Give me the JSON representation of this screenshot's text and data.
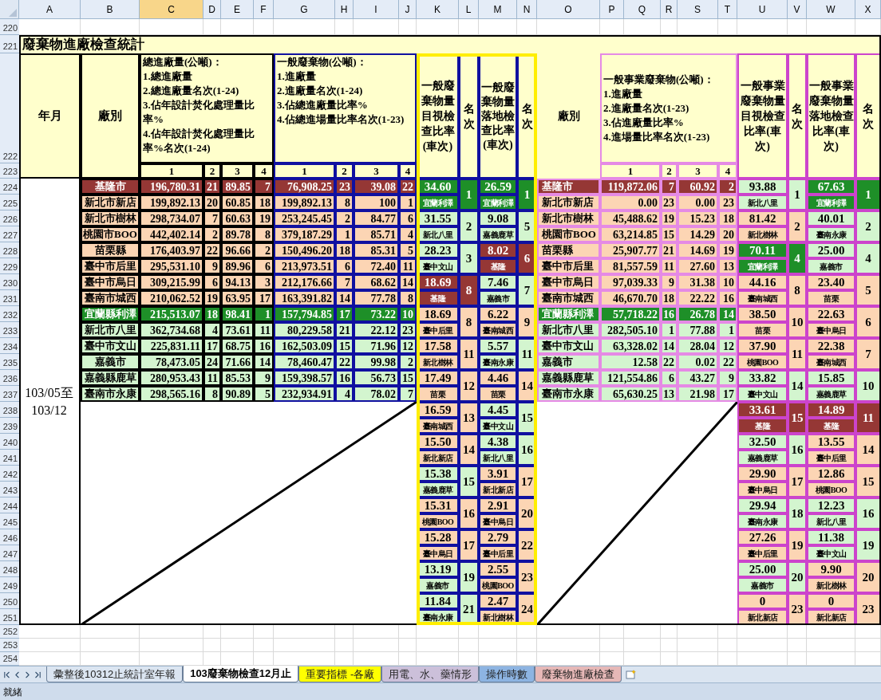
{
  "columns": [
    {
      "label": "A",
      "selected": false
    },
    {
      "label": "B",
      "selected": false
    },
    {
      "label": "C",
      "selected": true
    },
    {
      "label": "D",
      "selected": false
    },
    {
      "label": "E",
      "selected": false
    },
    {
      "label": "F",
      "selected": false
    },
    {
      "label": "G",
      "selected": false
    },
    {
      "label": "H",
      "selected": false
    },
    {
      "label": "I",
      "selected": false
    },
    {
      "label": "J",
      "selected": false
    },
    {
      "label": "K",
      "selected": false
    },
    {
      "label": "L",
      "selected": false
    },
    {
      "label": "M",
      "selected": false
    },
    {
      "label": "N",
      "selected": false
    },
    {
      "label": "O",
      "selected": false
    },
    {
      "label": "P",
      "selected": false
    },
    {
      "label": "Q",
      "selected": false
    },
    {
      "label": "R",
      "selected": false
    },
    {
      "label": "S",
      "selected": false
    },
    {
      "label": "T",
      "selected": false
    },
    {
      "label": "U",
      "selected": false
    },
    {
      "label": "V",
      "selected": false
    },
    {
      "label": "W",
      "selected": false
    },
    {
      "label": "X",
      "selected": false
    }
  ],
  "row_numbers": [
    "220",
    "221",
    "222",
    "223",
    "224",
    "225",
    "226",
    "227",
    "228",
    "229",
    "230",
    "231",
    "232",
    "233",
    "234",
    "235",
    "236",
    "237",
    "238",
    "239",
    "240",
    "241",
    "242",
    "243",
    "244",
    "245",
    "246",
    "247",
    "248",
    "249",
    "250",
    "251",
    "252",
    "253",
    "254"
  ],
  "title": "廢棄物進廠檢查統計",
  "left_table": {
    "period_header": "年月",
    "plant_header": "廠別",
    "total_header": "總進廠量(公噸)：\n1.總進廠量\n2.總進廠量名次(1-24)\n3.佔年設計焚化處理量比率%\n4.佔年設計焚化處理量比率%名次(1-24)",
    "total_subcolumns": [
      "1",
      "2",
      "3",
      "4"
    ],
    "general_header": "一般廢棄物(公噸)：\n1.進廠量\n2.進廠量名次(1-24)\n3.佔總進廠量比率%\n4.佔總進場量比率名次(1-23)",
    "general_subcolumns": [
      "1",
      "2",
      "3",
      "4"
    ],
    "period": "103/05至\n103/12",
    "rows": [
      {
        "plant": "基隆市",
        "color": "#953735",
        "values": [
          "196,780.31",
          "21",
          "89.85",
          "7",
          "76,908.25",
          "23",
          "39.08",
          "22"
        ]
      },
      {
        "plant": "新北市新店",
        "color": "#fcd5b4",
        "values": [
          "199,892.13",
          "20",
          "60.85",
          "18",
          "199,892.13",
          "8",
          "100",
          "1"
        ]
      },
      {
        "plant": "新北市樹林",
        "color": "#fcd5b4",
        "values": [
          "298,734.07",
          "7",
          "60.63",
          "19",
          "253,245.45",
          "2",
          "84.77",
          "6"
        ]
      },
      {
        "plant": "桃園市BOO",
        "color": "#fcd5b4",
        "values": [
          "442,402.14",
          "2",
          "89.78",
          "8",
          "379,187.29",
          "1",
          "85.71",
          "4"
        ]
      },
      {
        "plant": "苗栗縣",
        "color": "#fcd5b4",
        "values": [
          "176,403.97",
          "22",
          "96.66",
          "2",
          "150,496.20",
          "18",
          "85.31",
          "5"
        ]
      },
      {
        "plant": "臺中市后里",
        "color": "#fcd5b4",
        "values": [
          "295,531.10",
          "9",
          "89.96",
          "6",
          "213,973.51",
          "6",
          "72.40",
          "11"
        ]
      },
      {
        "plant": "臺中市烏日",
        "color": "#fcd5b4",
        "values": [
          "309,215.99",
          "6",
          "94.13",
          "3",
          "212,176.66",
          "7",
          "68.62",
          "14"
        ]
      },
      {
        "plant": "臺南市城西",
        "color": "#fcd5b4",
        "values": [
          "210,062.52",
          "19",
          "63.95",
          "17",
          "163,391.82",
          "14",
          "77.78",
          "8"
        ]
      },
      {
        "plant": "宜蘭縣利澤",
        "color": "#1e8f28",
        "values": [
          "215,513.07",
          "18",
          "98.41",
          "1",
          "157,794.85",
          "17",
          "73.22",
          "10"
        ]
      },
      {
        "plant": "新北市八里",
        "color": "#d3f5cf",
        "values": [
          "362,734.68",
          "4",
          "73.61",
          "11",
          "80,229.58",
          "21",
          "22.12",
          "23"
        ]
      },
      {
        "plant": "臺中市文山",
        "color": "#d3f5cf",
        "values": [
          "225,831.11",
          "17",
          "68.75",
          "16",
          "162,503.09",
          "15",
          "71.96",
          "12"
        ]
      },
      {
        "plant": "嘉義市",
        "color": "#d3f5cf",
        "values": [
          "78,473.05",
          "24",
          "71.66",
          "14",
          "78,460.47",
          "22",
          "99.98",
          "2"
        ]
      },
      {
        "plant": "嘉義縣鹿草",
        "color": "#d3f5cf",
        "values": [
          "280,953.43",
          "11",
          "85.53",
          "9",
          "159,398.57",
          "16",
          "56.73",
          "15"
        ]
      },
      {
        "plant": "臺南市永康",
        "color": "#d3f5cf",
        "values": [
          "298,565.16",
          "8",
          "90.89",
          "5",
          "232,934.91",
          "4",
          "78.02",
          "7"
        ]
      }
    ]
  },
  "general_inspection": {
    "visual_header": "一般廢棄物量目視檢查比率(車次)",
    "visual_rank_header": "名次",
    "landing_header": "一般廢棄物量落地檢查比率(車次)",
    "landing_rank_header": "名次",
    "visual": [
      {
        "value": "34.60",
        "plant": "宜蘭利澤",
        "rank": "1",
        "color": "#1e8f28"
      },
      {
        "value": "31.55",
        "plant": "新北八里",
        "rank": "2",
        "color": "#d3f5cf"
      },
      {
        "value": "28.23",
        "plant": "臺中文山",
        "rank": "3",
        "color": "#d3f5cf"
      },
      {
        "value": "18.69",
        "plant": "基隆",
        "rank": "8",
        "color": "#953735"
      },
      {
        "value": "18.69",
        "plant": "臺中后里",
        "rank": "8",
        "color": "#fcd5b4"
      },
      {
        "value": "17.58",
        "plant": "新北樹林",
        "rank": "11",
        "color": "#fcd5b4"
      },
      {
        "value": "17.49",
        "plant": "苗栗",
        "rank": "12",
        "color": "#fcd5b4"
      },
      {
        "value": "16.59",
        "plant": "臺南城西",
        "rank": "13",
        "color": "#fcd5b4"
      },
      {
        "value": "15.50",
        "plant": "新北新店",
        "rank": "14",
        "color": "#fcd5b4"
      },
      {
        "value": "15.38",
        "plant": "嘉義鹿草",
        "rank": "15",
        "color": "#d3f5cf"
      },
      {
        "value": "15.31",
        "plant": "桃園BOO",
        "rank": "16",
        "color": "#fcd5b4"
      },
      {
        "value": "15.28",
        "plant": "臺中烏日",
        "rank": "17",
        "color": "#fcd5b4"
      },
      {
        "value": "13.19",
        "plant": "嘉義市",
        "rank": "19",
        "color": "#d3f5cf"
      },
      {
        "value": "11.84",
        "plant": "臺南永康",
        "rank": "21",
        "color": "#d3f5cf"
      }
    ],
    "landing": [
      {
        "value": "26.59",
        "plant": "宜蘭利澤",
        "rank": "1",
        "color": "#1e8f28"
      },
      {
        "value": "9.08",
        "plant": "嘉義鹿草",
        "rank": "5",
        "color": "#d3f5cf"
      },
      {
        "value": "8.02",
        "plant": "基隆",
        "rank": "6",
        "color": "#953735"
      },
      {
        "value": "7.46",
        "plant": "嘉義市",
        "rank": "7",
        "color": "#d3f5cf"
      },
      {
        "value": "6.22",
        "plant": "臺南城西",
        "rank": "9",
        "color": "#fcd5b4"
      },
      {
        "value": "5.57",
        "plant": "臺南永康",
        "rank": "11",
        "color": "#d3f5cf"
      },
      {
        "value": "4.46",
        "plant": "苗栗",
        "rank": "14",
        "color": "#fcd5b4"
      },
      {
        "value": "4.45",
        "plant": "臺中文山",
        "rank": "15",
        "color": "#d3f5cf"
      },
      {
        "value": "4.38",
        "plant": "新北八里",
        "rank": "16",
        "color": "#d3f5cf"
      },
      {
        "value": "3.91",
        "plant": "新北新店",
        "rank": "17",
        "color": "#fcd5b4"
      },
      {
        "value": "2.91",
        "plant": "臺中烏日",
        "rank": "20",
        "color": "#fcd5b4"
      },
      {
        "value": "2.79",
        "plant": "臺中后里",
        "rank": "22",
        "color": "#fcd5b4"
      },
      {
        "value": "2.55",
        "plant": "桃園BOO",
        "rank": "23",
        "color": "#fcd5b4"
      },
      {
        "value": "2.47",
        "plant": "新北樹林",
        "rank": "24",
        "color": "#fcd5b4"
      }
    ]
  },
  "right_table": {
    "plant_header": "廠別",
    "header": "一般事業廢棄物(公噸)：\n1.進廠量\n2.進廠量名次(1-23)\n3.佔進廠量比率%\n4.進場量比率名次(1-23)",
    "subcolumns": [
      "1",
      "2",
      "3",
      "4"
    ],
    "rows": [
      {
        "plant": "基隆市",
        "color": "#953735",
        "values": [
          "119,872.06",
          "7",
          "60.92",
          "2"
        ]
      },
      {
        "plant": "新北市新店",
        "color": "#fcd5b4",
        "values": [
          "0.00",
          "23",
          "0.00",
          "23"
        ]
      },
      {
        "plant": "新北市樹林",
        "color": "#fcd5b4",
        "values": [
          "45,488.62",
          "19",
          "15.23",
          "18"
        ]
      },
      {
        "plant": "桃園市BOO",
        "color": "#fcd5b4",
        "values": [
          "63,214.85",
          "15",
          "14.29",
          "20"
        ]
      },
      {
        "plant": "苗栗縣",
        "color": "#fcd5b4",
        "values": [
          "25,907.77",
          "21",
          "14.69",
          "19"
        ]
      },
      {
        "plant": "臺中市后里",
        "color": "#fcd5b4",
        "values": [
          "81,557.59",
          "11",
          "27.60",
          "13"
        ]
      },
      {
        "plant": "臺中市烏日",
        "color": "#fcd5b4",
        "values": [
          "97,039.33",
          "9",
          "31.38",
          "10"
        ]
      },
      {
        "plant": "臺南市城西",
        "color": "#fcd5b4",
        "values": [
          "46,670.70",
          "18",
          "22.22",
          "16"
        ]
      },
      {
        "plant": "宜蘭縣利澤",
        "color": "#1e8f28",
        "values": [
          "57,718.22",
          "16",
          "26.78",
          "14"
        ]
      },
      {
        "plant": "新北市八里",
        "color": "#d3f5cf",
        "values": [
          "282,505.10",
          "1",
          "77.88",
          "1"
        ]
      },
      {
        "plant": "臺中市文山",
        "color": "#d3f5cf",
        "values": [
          "63,328.02",
          "14",
          "28.04",
          "12"
        ]
      },
      {
        "plant": "嘉義市",
        "color": "#d3f5cf",
        "values": [
          "12.58",
          "22",
          "0.02",
          "22"
        ]
      },
      {
        "plant": "嘉義縣鹿草",
        "color": "#d3f5cf",
        "values": [
          "121,554.86",
          "6",
          "43.27",
          "9"
        ]
      },
      {
        "plant": "臺南市永康",
        "color": "#d3f5cf",
        "values": [
          "65,630.25",
          "13",
          "21.98",
          "17"
        ]
      }
    ]
  },
  "business_inspection": {
    "visual_header": "一般事業廢棄物量目視檢查比率(車次)",
    "visual_rank_header": "名次",
    "landing_header": "一般事業廢棄物量落地檢查比率(車次)",
    "landing_rank_header": "名次",
    "visual": [
      {
        "value": "93.88",
        "plant": "新北八里",
        "rank": "1",
        "color": "#d3f5cf"
      },
      {
        "value": "81.42",
        "plant": "新北樹林",
        "rank": "2",
        "color": "#fcd5b4"
      },
      {
        "value": "70.11",
        "plant": "宜蘭利澤",
        "rank": "4",
        "color": "#1e8f28"
      },
      {
        "value": "44.16",
        "plant": "臺南城西",
        "rank": "8",
        "color": "#fcd5b4"
      },
      {
        "value": "38.50",
        "plant": "苗栗",
        "rank": "10",
        "color": "#fcd5b4"
      },
      {
        "value": "37.90",
        "plant": "桃園BOO",
        "rank": "11",
        "color": "#fcd5b4"
      },
      {
        "value": "33.82",
        "plant": "臺中文山",
        "rank": "14",
        "color": "#d3f5cf"
      },
      {
        "value": "33.61",
        "plant": "基隆",
        "rank": "15",
        "color": "#953735"
      },
      {
        "value": "32.50",
        "plant": "嘉義鹿草",
        "rank": "16",
        "color": "#d3f5cf"
      },
      {
        "value": "29.90",
        "plant": "臺中烏日",
        "rank": "17",
        "color": "#fcd5b4"
      },
      {
        "value": "29.94",
        "plant": "臺南永康",
        "rank": "18",
        "color": "#d3f5cf"
      },
      {
        "value": "27.26",
        "plant": "臺中后里",
        "rank": "19",
        "color": "#fcd5b4"
      },
      {
        "value": "25.00",
        "plant": "嘉義市",
        "rank": "20",
        "color": "#d3f5cf"
      },
      {
        "value": "0",
        "plant": "新北新店",
        "rank": "23",
        "color": "#fcd5b4"
      }
    ],
    "landing": [
      {
        "value": "67.63",
        "plant": "宜蘭利澤",
        "rank": "1",
        "color": "#1e8f28"
      },
      {
        "value": "40.01",
        "plant": "臺南永康",
        "rank": "2",
        "color": "#d3f5cf"
      },
      {
        "value": "25.00",
        "plant": "嘉義市",
        "rank": "4",
        "color": "#d3f5cf"
      },
      {
        "value": "23.40",
        "plant": "苗栗",
        "rank": "5",
        "color": "#fcd5b4"
      },
      {
        "value": "22.63",
        "plant": "臺中烏日",
        "rank": "6",
        "color": "#fcd5b4"
      },
      {
        "value": "22.38",
        "plant": "臺南城西",
        "rank": "7",
        "color": "#fcd5b4"
      },
      {
        "value": "15.85",
        "plant": "嘉義鹿草",
        "rank": "10",
        "color": "#d3f5cf"
      },
      {
        "value": "14.89",
        "plant": "基隆",
        "rank": "11",
        "color": "#953735"
      },
      {
        "value": "13.55",
        "plant": "臺中后里",
        "rank": "14",
        "color": "#fcd5b4"
      },
      {
        "value": "12.86",
        "plant": "桃園BOO",
        "rank": "15",
        "color": "#fcd5b4"
      },
      {
        "value": "12.23",
        "plant": "新北八里",
        "rank": "16",
        "color": "#d3f5cf"
      },
      {
        "value": "11.38",
        "plant": "臺中文山",
        "rank": "19",
        "color": "#d3f5cf"
      },
      {
        "value": "9.90",
        "plant": "新北樹林",
        "rank": "20",
        "color": "#fcd5b4"
      },
      {
        "value": "0",
        "plant": "新北新店",
        "rank": "23",
        "color": "#fcd5b4"
      }
    ]
  },
  "sheet_tabs": [
    {
      "label": "彙整後10312止統計室年報",
      "selected": false,
      "color": "#dbe5f1"
    },
    {
      "label": "103廢棄物檢查12月止",
      "selected": true,
      "color": "#ffffff"
    },
    {
      "label": "重要指標 -各廠",
      "selected": false,
      "color": "#ffff00"
    },
    {
      "label": "用電、水、藥情形",
      "selected": false,
      "color": "#ccc0da"
    },
    {
      "label": "操作時數",
      "selected": false,
      "color": "#8db4e2"
    },
    {
      "label": "廢棄物進廠檢查",
      "selected": false,
      "color": "#e6b8b7"
    }
  ],
  "status_bar": "就緒"
}
